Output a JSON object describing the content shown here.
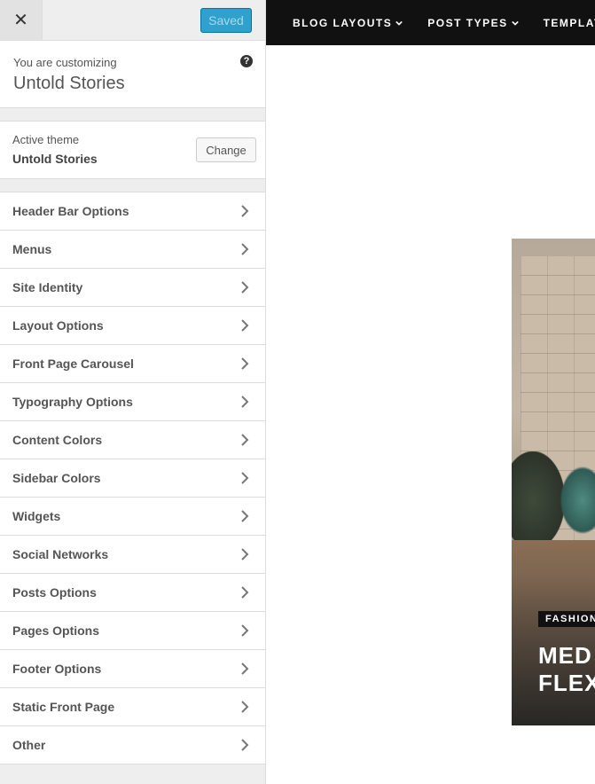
{
  "topbar": {
    "close_icon": "close-icon",
    "saved_label": "Saved"
  },
  "info": {
    "subtitle": "You are customizing",
    "site_title": "Untold Stories",
    "help_icon": "help-icon"
  },
  "theme": {
    "label": "Active theme",
    "name": "Untold Stories",
    "change_label": "Change"
  },
  "menu": {
    "items": [
      {
        "label": "Header Bar Options"
      },
      {
        "label": "Menus"
      },
      {
        "label": "Site Identity"
      },
      {
        "label": "Layout Options"
      },
      {
        "label": "Front Page Carousel"
      },
      {
        "label": "Typography Options"
      },
      {
        "label": "Content Colors"
      },
      {
        "label": "Sidebar Colors"
      },
      {
        "label": "Widgets"
      },
      {
        "label": "Social Networks"
      },
      {
        "label": "Posts Options"
      },
      {
        "label": "Pages Options"
      },
      {
        "label": "Footer Options"
      },
      {
        "label": "Static Front Page"
      },
      {
        "label": "Other"
      }
    ]
  },
  "preview": {
    "nav": [
      "BLOG LAYOUTS",
      "POST TYPES",
      "TEMPLATE"
    ],
    "hero": {
      "tag": "FASHION",
      "title_line1": "MED",
      "title_line2": "FLEX"
    }
  },
  "colors": {
    "accent": "#2ea2cc",
    "nav_bg": "#111111",
    "sidebar_bg": "#eeeeee"
  }
}
